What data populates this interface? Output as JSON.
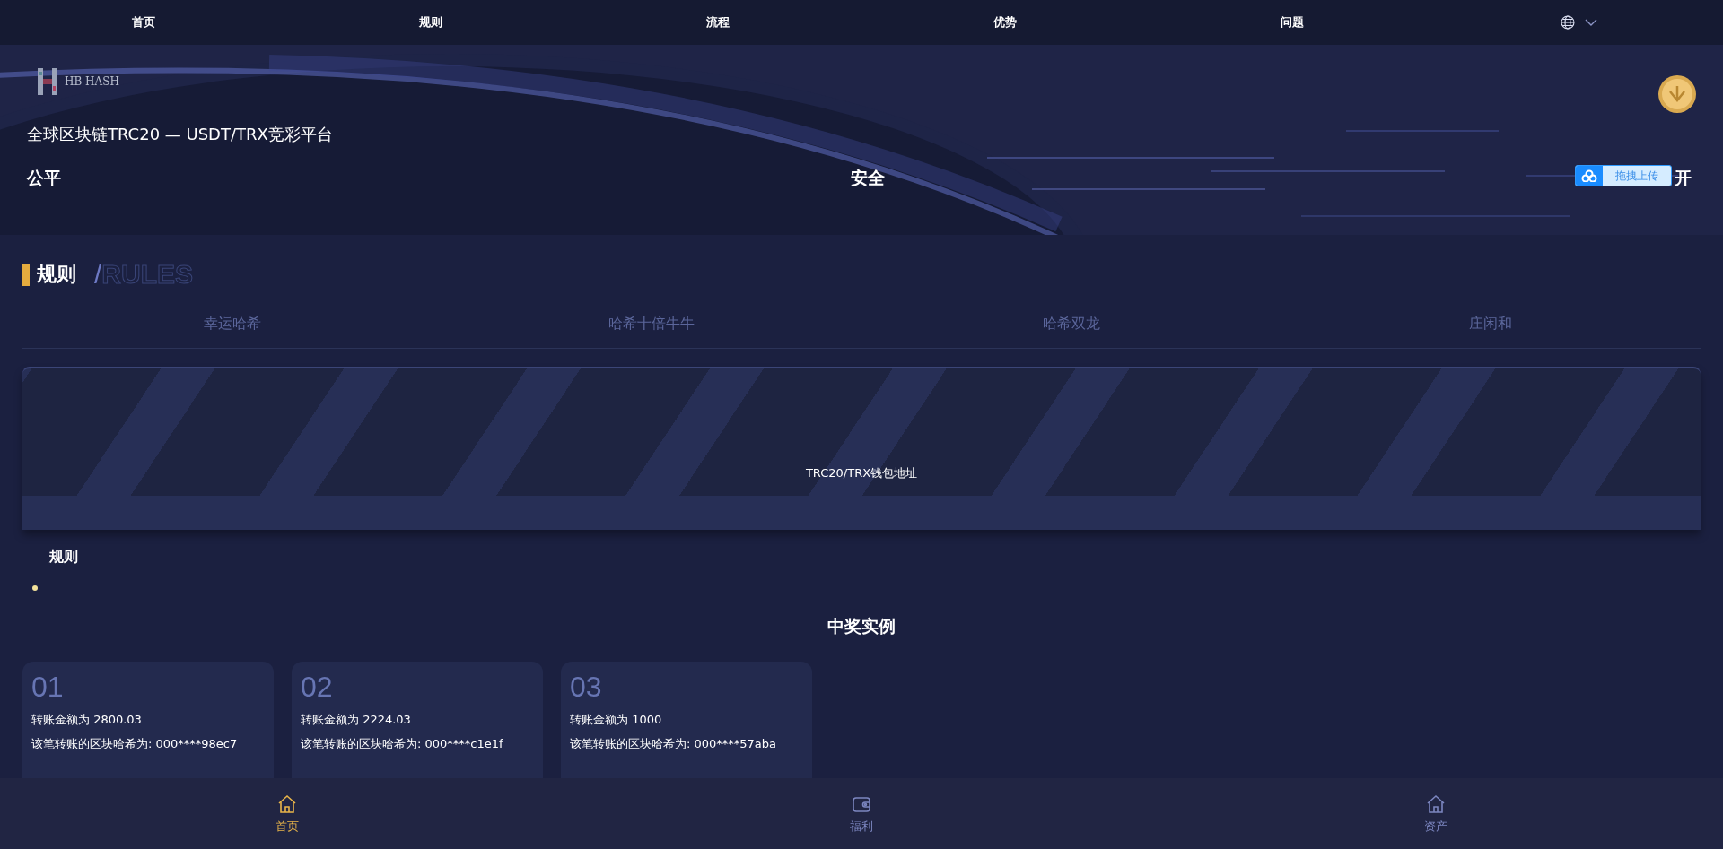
{
  "top_nav": {
    "items": [
      {
        "label": "首页"
      },
      {
        "label": "规则"
      },
      {
        "label": "流程"
      },
      {
        "label": "优势"
      },
      {
        "label": "问题"
      }
    ]
  },
  "hero": {
    "brand": "HB HASH",
    "title": "全球区块链TRC20 — USDT/TRX竞彩平台",
    "features": [
      "公平",
      "安全",
      "开"
    ],
    "upload_badge": {
      "label": "拖拽上传"
    }
  },
  "rules": {
    "heading": "规则",
    "heading_sep": "/",
    "heading_en": "RULES",
    "tabs": [
      {
        "label": "幸运哈希",
        "selected": false
      },
      {
        "label": "哈希十倍牛牛",
        "selected": false
      },
      {
        "label": "哈希双龙",
        "selected": false
      },
      {
        "label": "庄闲和",
        "selected": false
      }
    ],
    "address_banner": {
      "label": "TRC20/TRX钱包地址"
    },
    "subheading": "规则"
  },
  "examples": {
    "heading": "中奖实例",
    "cards": [
      {
        "number": "01",
        "lines": [
          "转账金额为 2800.03",
          "该笔转账的区块哈希为: 000****98ec7"
        ]
      },
      {
        "number": "02",
        "lines": [
          "转账金额为 2224.03",
          "该笔转账的区块哈希为: 000****c1e1f"
        ]
      },
      {
        "number": "03",
        "lines": [
          "转账金额为 1000",
          "该笔转账的区块哈希为: 000****57aba"
        ]
      }
    ]
  },
  "bottom_nav": [
    {
      "label": "首页",
      "kind": "home",
      "selected": true
    },
    {
      "label": "福利",
      "kind": "wallet",
      "selected": false
    },
    {
      "label": "资产",
      "kind": "home",
      "selected": false
    }
  ]
}
